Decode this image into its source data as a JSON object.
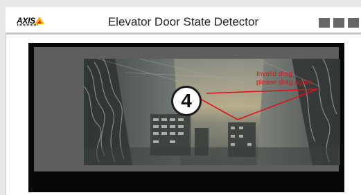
{
  "app": {
    "title": "Elevator Door State Detector",
    "logo_text": "AXIS"
  },
  "window_controls": [
    "minimize-button",
    "maximize-button",
    "close-button"
  ],
  "video": {
    "step_marker": "4",
    "error_message": "Invalid drag,\nplease drag again"
  },
  "colors": {
    "error": "#d9141b",
    "logo_accent": "#f5b400",
    "frame": "#070707",
    "panel": "#5e5e5e"
  }
}
